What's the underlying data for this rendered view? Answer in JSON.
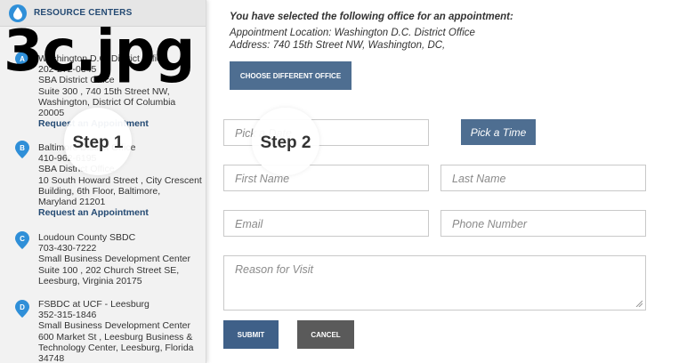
{
  "sidebar": {
    "title": "RESOURCE CENTERS",
    "entries": [
      {
        "marker": "A",
        "lines": [
          "Washington D.C. District Office",
          "202-272-0345",
          "SBA District Office",
          "Suite 300 , 740 15th Street NW,",
          "Washington, District Of Columbia",
          "20005"
        ],
        "request": "Request an Appointment"
      },
      {
        "marker": "B",
        "lines": [
          "Baltimore District Office",
          "410-962-6195",
          "SBA District Office",
          "10 South Howard Street , City Crescent",
          "Building, 6th Floor, Baltimore,",
          "Maryland 21201"
        ],
        "request": "Request an Appointment"
      },
      {
        "marker": "C",
        "lines": [
          "Loudoun County SBDC",
          "703-430-7222",
          "Small Business Development Center",
          "Suite 100 , 202 Church Street SE,",
          "Leesburg, Virginia 20175"
        ]
      },
      {
        "marker": "D",
        "lines": [
          "FSBDC at UCF - Leesburg",
          "352-315-1846",
          "Small Business Development Center",
          "600 Market St , Leesburg Business &",
          "Technology Center, Leesburg, Florida",
          "34748"
        ]
      }
    ]
  },
  "overlay": {
    "filename": "3c.jpg",
    "step1": "Step 1",
    "step2": "Step 2"
  },
  "selection": {
    "heading": "You have selected the following office for an appointment:",
    "location": "Appointment Location: Washington D.C. District Office",
    "address": "Address: 740 15th Street NW, Washington, DC,"
  },
  "form": {
    "change_office": "CHOOSE DIFFERENT OFFICE",
    "pick_date_placeholder": "Pick a Date",
    "pick_time": "Pick a Time",
    "first_name": "First Name",
    "last_name": "Last Name",
    "email": "Email",
    "phone": "Phone Number",
    "reason": "Reason for Visit",
    "submit": "SUBMIT",
    "cancel": "CANCEL"
  },
  "colors": {
    "accent": "#4e6e91",
    "marker": "#2f8fd8",
    "link": "#244a73",
    "cancel": "#5a5a5a"
  }
}
